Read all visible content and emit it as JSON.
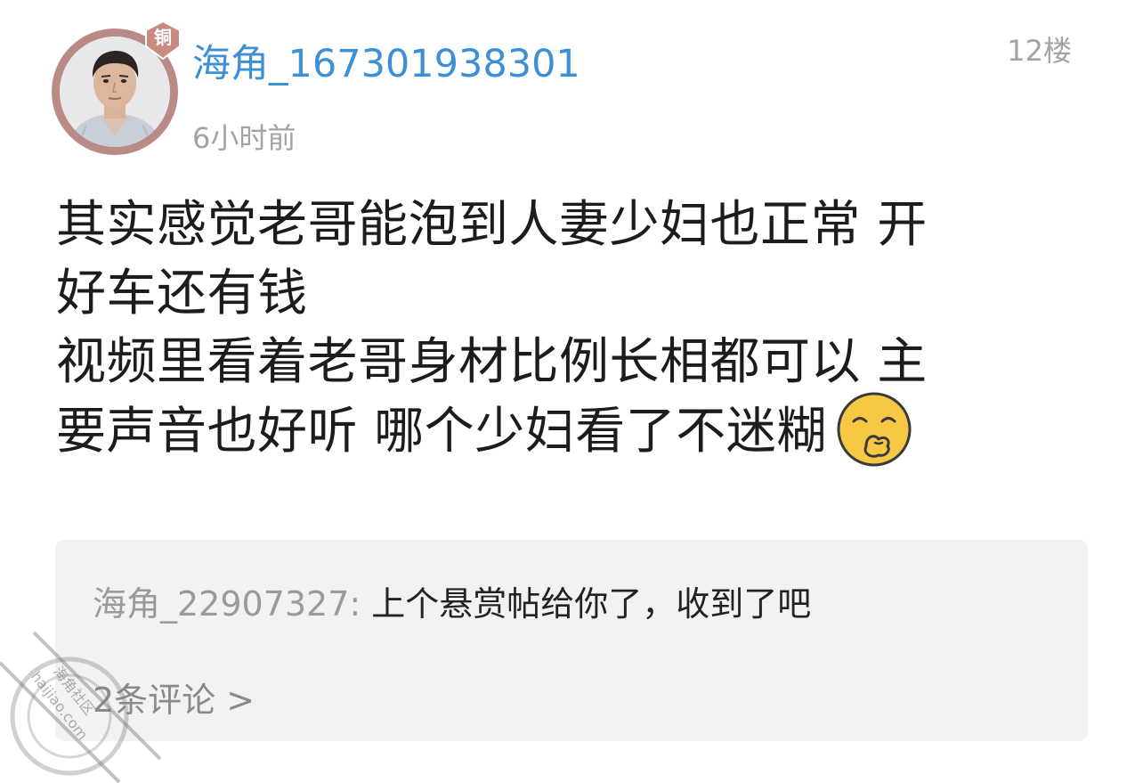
{
  "header": {
    "username": "海角_167301938301",
    "timestamp": "6小时前",
    "floor": "12楼",
    "rank_badge": "铜"
  },
  "post": {
    "lines": [
      "其实感觉老哥能泡到人妻少妇也正常 开",
      "好车还有钱",
      "视频里看着老哥身材比例长相都可以 主",
      "要声音也好听 哪个少妇看了不迷糊"
    ],
    "emoji": "smirk-emoji"
  },
  "reply": {
    "author": "海角_22907327:",
    "text": " 上个悬赏帖给你了，收到了吧",
    "count_label": "2条评论 >"
  },
  "watermark": {
    "text_cn": "海角社区",
    "text_en": "haijiao.com"
  },
  "colors": {
    "username": "#3d8fd6",
    "meta_gray": "#a3a3a3",
    "avatar_ring": "#b98a86",
    "badge": "#c98b7f",
    "reply_bg": "#f2f2f4",
    "emoji_yellow": "#f7c843"
  }
}
